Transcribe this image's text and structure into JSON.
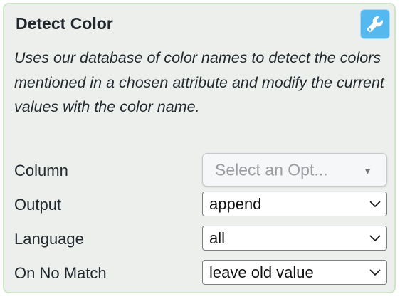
{
  "panel": {
    "title": "Detect Color",
    "settings_icon": "wrench-icon",
    "description": "Uses our database of color names to detect the colors mentioned in a chosen attribute and modify the current values with the color name."
  },
  "fields": {
    "column": {
      "label": "Column",
      "placeholder": "Select an Opt...",
      "icon": "triangle-down-icon"
    },
    "output": {
      "label": "Output",
      "value": "append",
      "icon": "chevron-down-icon"
    },
    "language": {
      "label": "Language",
      "value": "all",
      "icon": "chevron-down-icon"
    },
    "no_match": {
      "label": "On No Match",
      "value": "leave old value",
      "icon": "chevron-down-icon"
    }
  },
  "colors": {
    "panel_background": "#ecefec",
    "panel_border": "#cfe6c8",
    "accent_button": "#55b8ee",
    "text": "#22292e"
  }
}
